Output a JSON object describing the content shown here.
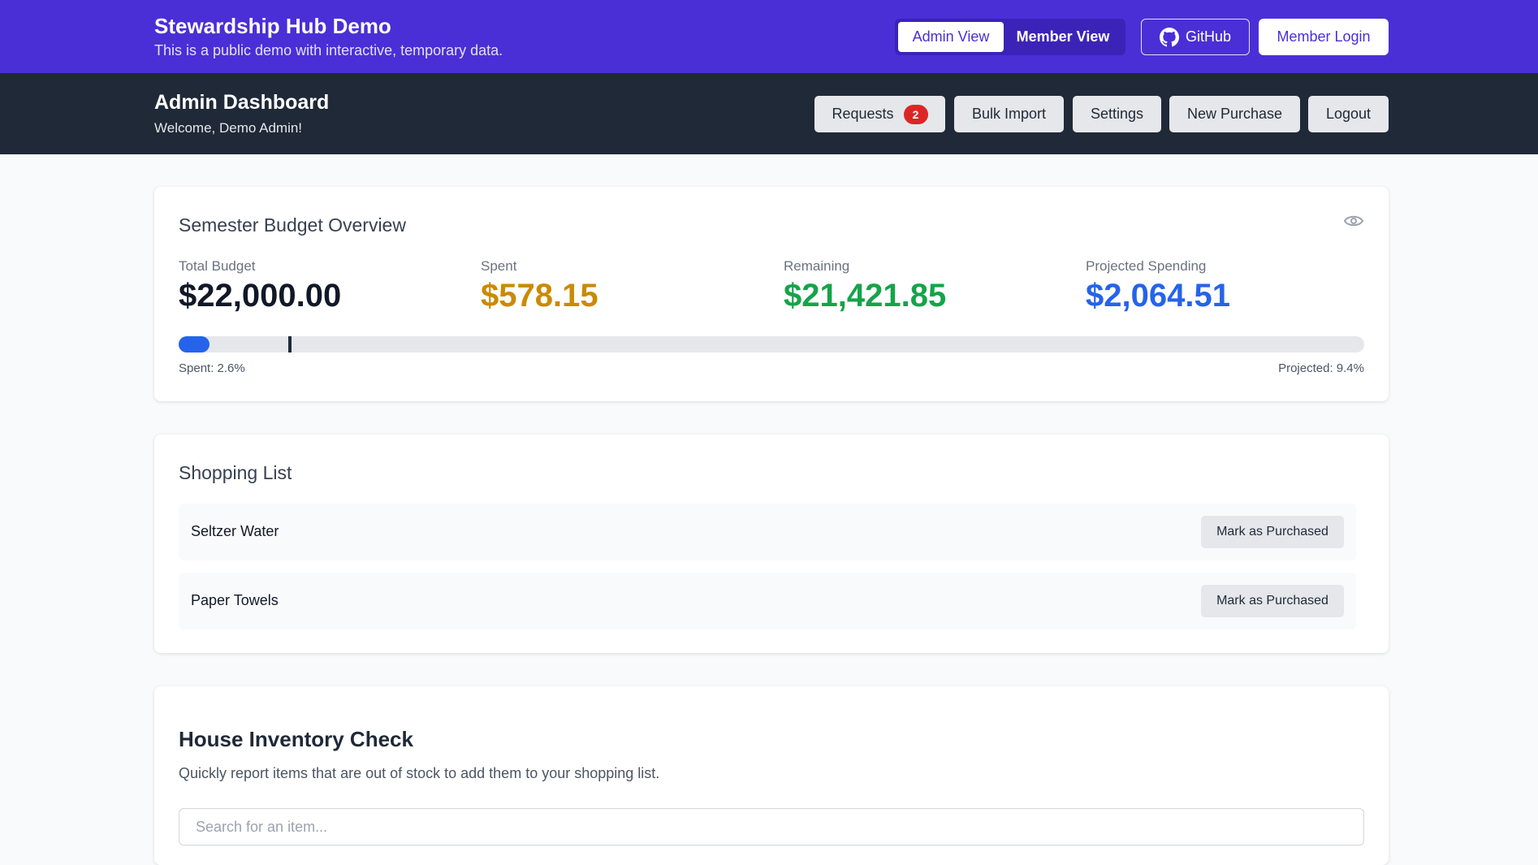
{
  "demo": {
    "title": "Stewardship Hub Demo",
    "subtitle": "This is a public demo with interactive, temporary data.",
    "admin_view": "Admin View",
    "member_view": "Member View",
    "github": "GitHub",
    "member_login": "Member Login"
  },
  "header": {
    "title": "Admin Dashboard",
    "welcome": "Welcome, Demo Admin!",
    "buttons": {
      "requests": "Requests",
      "requests_count": "2",
      "bulk_import": "Bulk Import",
      "settings": "Settings",
      "new_purchase": "New Purchase",
      "logout": "Logout"
    }
  },
  "budget": {
    "title": "Semester Budget Overview",
    "total_label": "Total Budget",
    "total_value": "$22,000.00",
    "spent_label": "Spent",
    "spent_value": "$578.15",
    "remaining_label": "Remaining",
    "remaining_value": "$21,421.85",
    "projected_label": "Projected Spending",
    "projected_value": "$2,064.51",
    "spent_pct_text": "Spent: 2.6%",
    "projected_pct_text": "Projected: 9.4%",
    "spent_fraction": 0.026,
    "projected_fraction": 0.094,
    "colors": {
      "total": "#111827",
      "spent": "#ca8a04",
      "remaining": "#16a34a",
      "projected": "#2563eb"
    }
  },
  "shopping": {
    "title": "Shopping List",
    "action_label": "Mark as Purchased",
    "items": [
      "Seltzer Water",
      "Paper Towels"
    ]
  },
  "inventory": {
    "title": "House Inventory Check",
    "subtitle": "Quickly report items that are out of stock to add them to your shopping list.",
    "search_placeholder": "Search for an item..."
  }
}
